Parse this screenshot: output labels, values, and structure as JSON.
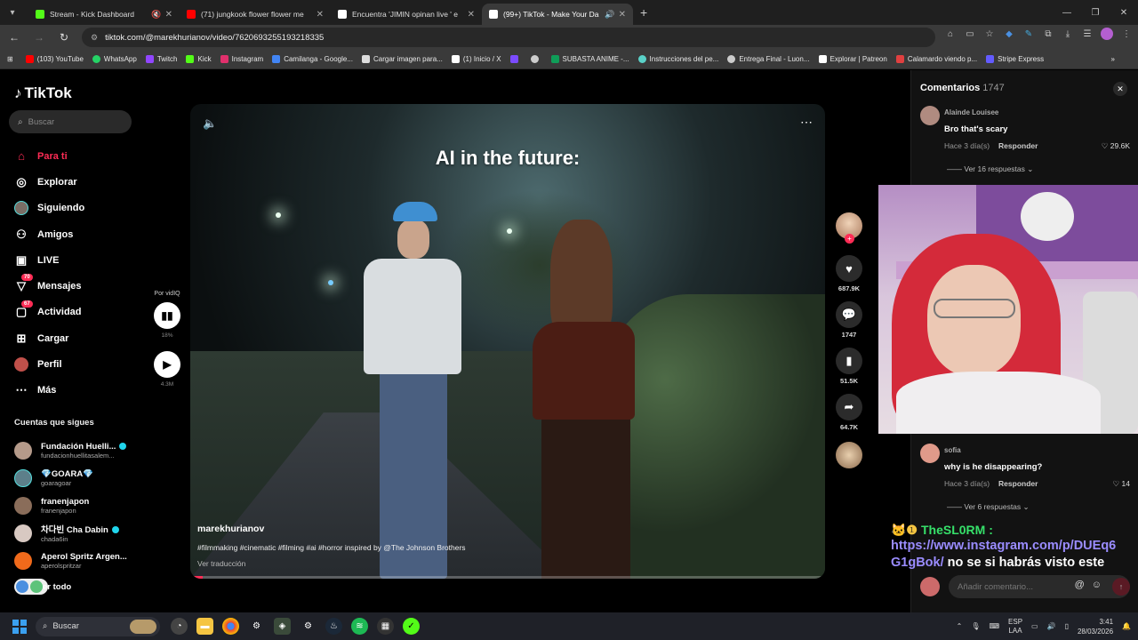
{
  "browser": {
    "tabs": [
      {
        "title": "Stream - Kick Dashboard",
        "favicon_color": "#53fc18",
        "active": false,
        "muted": true
      },
      {
        "title": "(71) jungkook flower flower me",
        "favicon_color": "#ff0000",
        "active": false,
        "muted": false
      },
      {
        "title": "Encuentra 'JIMIN opinan live ' e",
        "favicon_color": "#ffffff",
        "active": false,
        "muted": false
      },
      {
        "title": "(99+) TikTok - Make Your Da",
        "favicon_color": "#ffffff",
        "active": true,
        "muted": false
      }
    ],
    "url": "tiktok.com/@marekhurianov/video/7620693255193218335",
    "bookmarks": [
      {
        "label": "(103) YouTube",
        "color": "#ff0000"
      },
      {
        "label": "WhatsApp",
        "color": "#25d366"
      },
      {
        "label": "Twitch",
        "color": "#9146ff"
      },
      {
        "label": "Kick",
        "color": "#53fc18"
      },
      {
        "label": "Instagram",
        "color": "#e1306c"
      },
      {
        "label": "Camilanga - Google...",
        "color": "#4285f4"
      },
      {
        "label": "Cargar imagen para...",
        "color": "#dddddd"
      },
      {
        "label": "(1) Inicio / X",
        "color": "#ffffff"
      },
      {
        "label": "",
        "color": "#7b4bff"
      },
      {
        "label": "",
        "color": "#cccccc"
      },
      {
        "label": "SUBASTA ANIME -...",
        "color": "#0f9d58"
      },
      {
        "label": "Instrucciones del pe...",
        "color": "#5ad1c8"
      },
      {
        "label": "Entrega Final - Luon...",
        "color": "#cccccc"
      },
      {
        "label": "Explorar | Patreon",
        "color": "#ffffff"
      },
      {
        "label": "Calamardo viendo p...",
        "color": "#e04040"
      },
      {
        "label": "Stripe Express",
        "color": "#635bff"
      }
    ]
  },
  "sidebar": {
    "logo": "TikTok",
    "search_placeholder": "Buscar",
    "nav": [
      {
        "label": "Para ti",
        "icon": "home-icon",
        "active": true
      },
      {
        "label": "Explorar",
        "icon": "compass-icon"
      },
      {
        "label": "Siguiendo",
        "icon": "avatar-icon"
      },
      {
        "label": "Amigos",
        "icon": "friends-icon"
      },
      {
        "label": "LIVE",
        "icon": "live-icon"
      },
      {
        "label": "Mensajes",
        "icon": "send-icon",
        "badge": "70"
      },
      {
        "label": "Actividad",
        "icon": "inbox-icon",
        "badge": "67"
      },
      {
        "label": "Cargar",
        "icon": "plus-square-icon"
      },
      {
        "label": "Perfil",
        "icon": "profile-icon"
      },
      {
        "label": "Más",
        "icon": "more-icon"
      }
    ],
    "following_title": "Cuentas que sigues",
    "following": [
      {
        "name": "Fundación Huelli...",
        "handle": "fundacionhuellitasalem...",
        "verified": true,
        "color": "#b59a8a"
      },
      {
        "name": "💎GOARA💎",
        "handle": "goaragoar",
        "verified": false,
        "color": "#5d7f8a"
      },
      {
        "name": "franenjapon",
        "handle": "franenjapon",
        "verified": false,
        "color": "#8a6d5a"
      },
      {
        "name": "차다빈 Cha Dabin",
        "handle": "chada6in",
        "verified": true,
        "color": "#d8c9c2"
      },
      {
        "name": "Aperol Spritz Argen...",
        "handle": "aperolspritzar",
        "verified": false,
        "color": "#f06a1b"
      }
    ],
    "see_all": "er todo"
  },
  "vidiq": {
    "label": "Por vidIQ",
    "percent": "18%",
    "views": "4.3M"
  },
  "video": {
    "overlay_title": "AI in the future:",
    "author": "marekhurianov",
    "description": "#filmmaking #cinematic #filming #ai #horror inspired by @The Johnson Brothers",
    "translate": "Ver traducción",
    "progress": 0.02
  },
  "actions": {
    "likes": "687.9K",
    "comments": "1747",
    "saves": "51.5K",
    "shares": "64.7K"
  },
  "comments": {
    "title": "Comentarios",
    "count": "1747",
    "items": [
      {
        "user": "Alainde Louisee",
        "text": "Bro that's scary",
        "time": "Hace 3 día(s)",
        "reply": "Responder",
        "likes": "29.6K",
        "more": "Ver 16 respuestas",
        "color": "#b08b80"
      },
      {
        "user": "sofia",
        "text": "why is he disappearing?",
        "time": "Hace 3 día(s)",
        "reply": "Responder",
        "likes": "14",
        "more": "Ver 6 respuestas",
        "color": "#e09a8a"
      }
    ],
    "input_placeholder": "Añadir comentario..."
  },
  "chat": {
    "username": "TheSL0RM :",
    "link_part1": "https://www.instagram.com/p/DUEq6",
    "link_part2": "G1gBok/",
    "message": "no se si habrás visto este"
  },
  "taskbar": {
    "search": "Buscar",
    "lang_top": "ESP",
    "lang_bottom": "LAA",
    "time": "3:41",
    "date": "28/03/2026"
  }
}
